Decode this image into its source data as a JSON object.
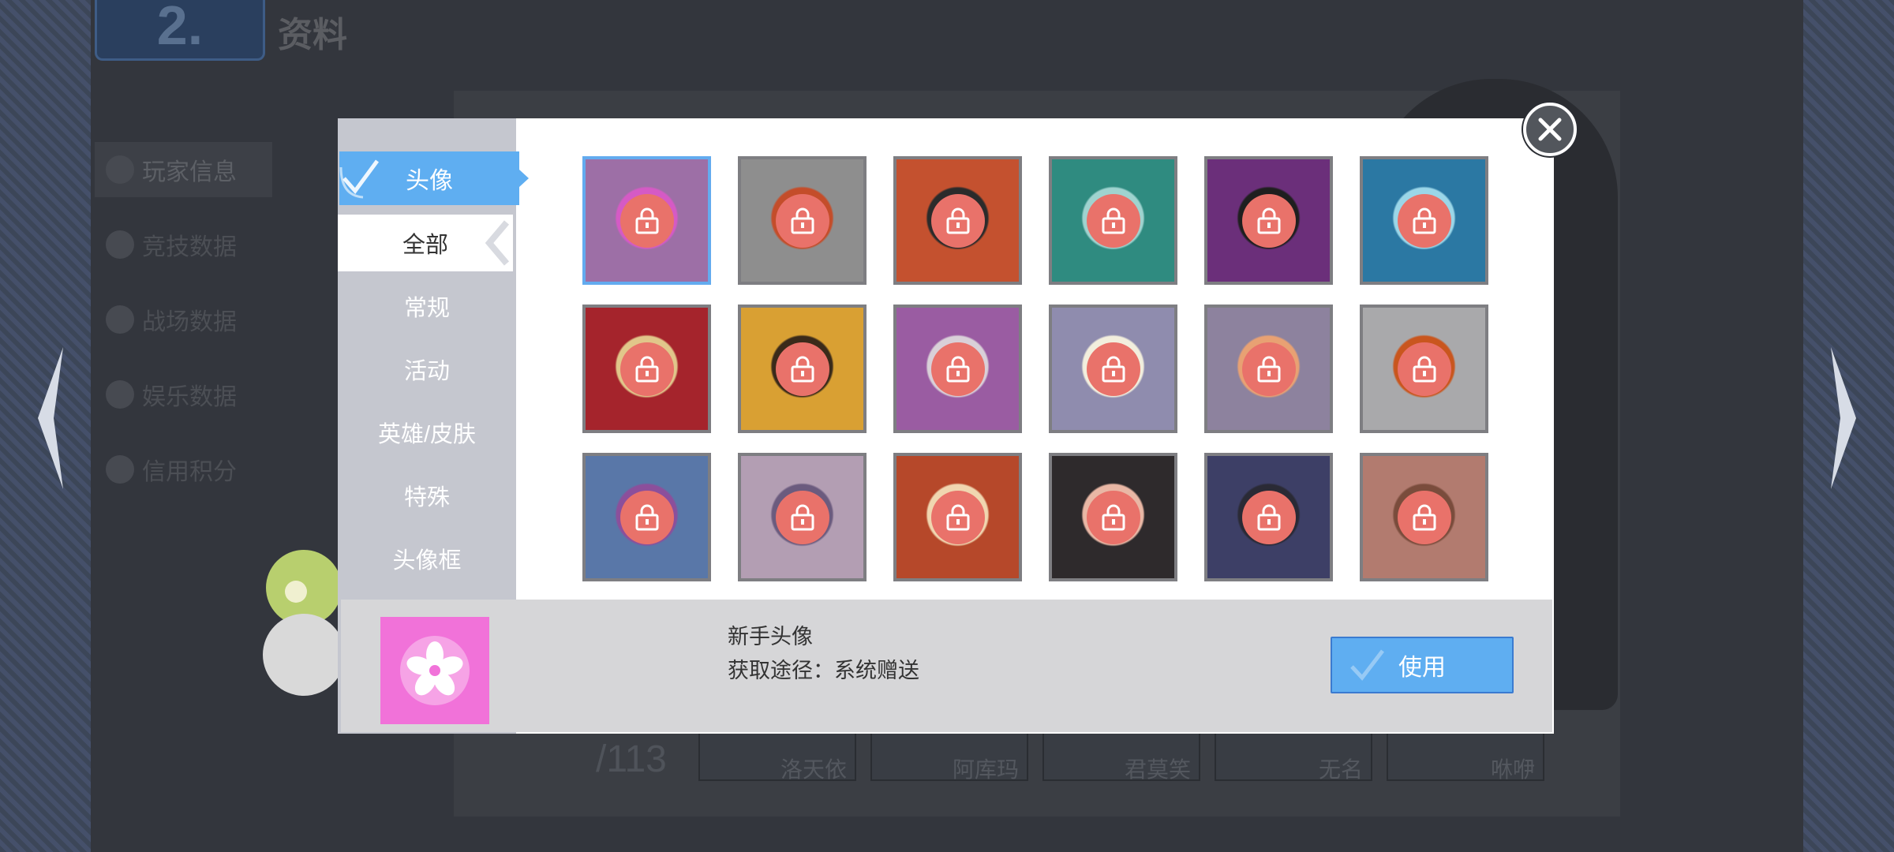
{
  "background": {
    "section_title": "资料",
    "section_number": "2.",
    "nav": [
      {
        "label": "玩家信息",
        "active": true
      },
      {
        "label": "竞技数据",
        "active": false
      },
      {
        "label": "战场数据",
        "active": false
      },
      {
        "label": "娱乐数据",
        "active": false
      },
      {
        "label": "信用积分",
        "active": false
      }
    ],
    "count": "/113",
    "heroes": [
      "洛天依",
      "阿库玛",
      "君莫笑",
      "无名",
      "咻咿"
    ]
  },
  "dialog": {
    "tab_label": "头像",
    "categories": [
      {
        "label": "全部",
        "selected": true
      },
      {
        "label": "常规",
        "selected": false
      },
      {
        "label": "活动",
        "selected": false
      },
      {
        "label": "英雄/皮肤",
        "selected": false
      },
      {
        "label": "特殊",
        "selected": false
      },
      {
        "label": "头像框",
        "selected": false
      }
    ],
    "avatars": [
      {
        "name": "sakura-emblem",
        "bg": "#9d6fa6",
        "accent": "#d55ac5",
        "locked": true,
        "selected": true
      },
      {
        "name": "flame-emblem",
        "bg": "#8e8e8e",
        "accent": "#c44d2a",
        "locked": true,
        "selected": false
      },
      {
        "name": "armor-emblem",
        "bg": "#c4512f",
        "accent": "#2b2b2b",
        "locked": true,
        "selected": false
      },
      {
        "name": "dragon-emblem",
        "bg": "#2f8b80",
        "accent": "#9fd3cf",
        "locked": true,
        "selected": false
      },
      {
        "name": "dark-mask-emblem",
        "bg": "#6b2f7a",
        "accent": "#1f1f1f",
        "locked": true,
        "selected": false
      },
      {
        "name": "horned-mask-emblem",
        "bg": "#2b78a3",
        "accent": "#9bd6e8",
        "locked": true,
        "selected": false
      },
      {
        "name": "fox-emblem",
        "bg": "#a5242c",
        "accent": "#e1c68a",
        "locked": true,
        "selected": false
      },
      {
        "name": "hexagon-emblem",
        "bg": "#d9a033",
        "accent": "#3a2a1a",
        "locked": true,
        "selected": false
      },
      {
        "name": "blob-emblem",
        "bg": "#9a5ca2",
        "accent": "#d9d0d8",
        "locked": true,
        "selected": false
      },
      {
        "name": "lucky-cat-emblem",
        "bg": "#8f8cae",
        "accent": "#f2eedd",
        "locked": true,
        "selected": false
      },
      {
        "name": "fan-emblem",
        "bg": "#8d829e",
        "accent": "#e8a173",
        "locked": true,
        "selected": false
      },
      {
        "name": "koi-emblem",
        "bg": "#a9a9ab",
        "accent": "#c9561e",
        "locked": true,
        "selected": false
      },
      {
        "name": "hero-portrait-1",
        "bg": "#5977a8",
        "accent": "#8c4f9b",
        "locked": true,
        "selected": false
      },
      {
        "name": "hero-portrait-2",
        "bg": "#b39eb3",
        "accent": "#6b5b7e",
        "locked": true,
        "selected": false
      },
      {
        "name": "hero-portrait-3",
        "bg": "#b6482a",
        "accent": "#f0d6b0",
        "locked": true,
        "selected": false
      },
      {
        "name": "hero-portrait-4",
        "bg": "#2e2a2c",
        "accent": "#e9b7a5",
        "locked": true,
        "selected": false
      },
      {
        "name": "hero-portrait-5",
        "bg": "#3d3f66",
        "accent": "#2a2a35",
        "locked": true,
        "selected": false
      },
      {
        "name": "hero-portrait-6",
        "bg": "#b27b6f",
        "accent": "#7a4c3c",
        "locked": true,
        "selected": false
      }
    ],
    "detail": {
      "name": "新手头像",
      "source": "获取途径：系统赠送",
      "thumb_color": "#f172d9"
    },
    "use_button": "使用"
  },
  "colors": {
    "accent": "#5faef1",
    "lock": "#e9726a"
  },
  "icons": {
    "close": "close-icon",
    "lock": "lock-icon",
    "check": "check-icon"
  }
}
